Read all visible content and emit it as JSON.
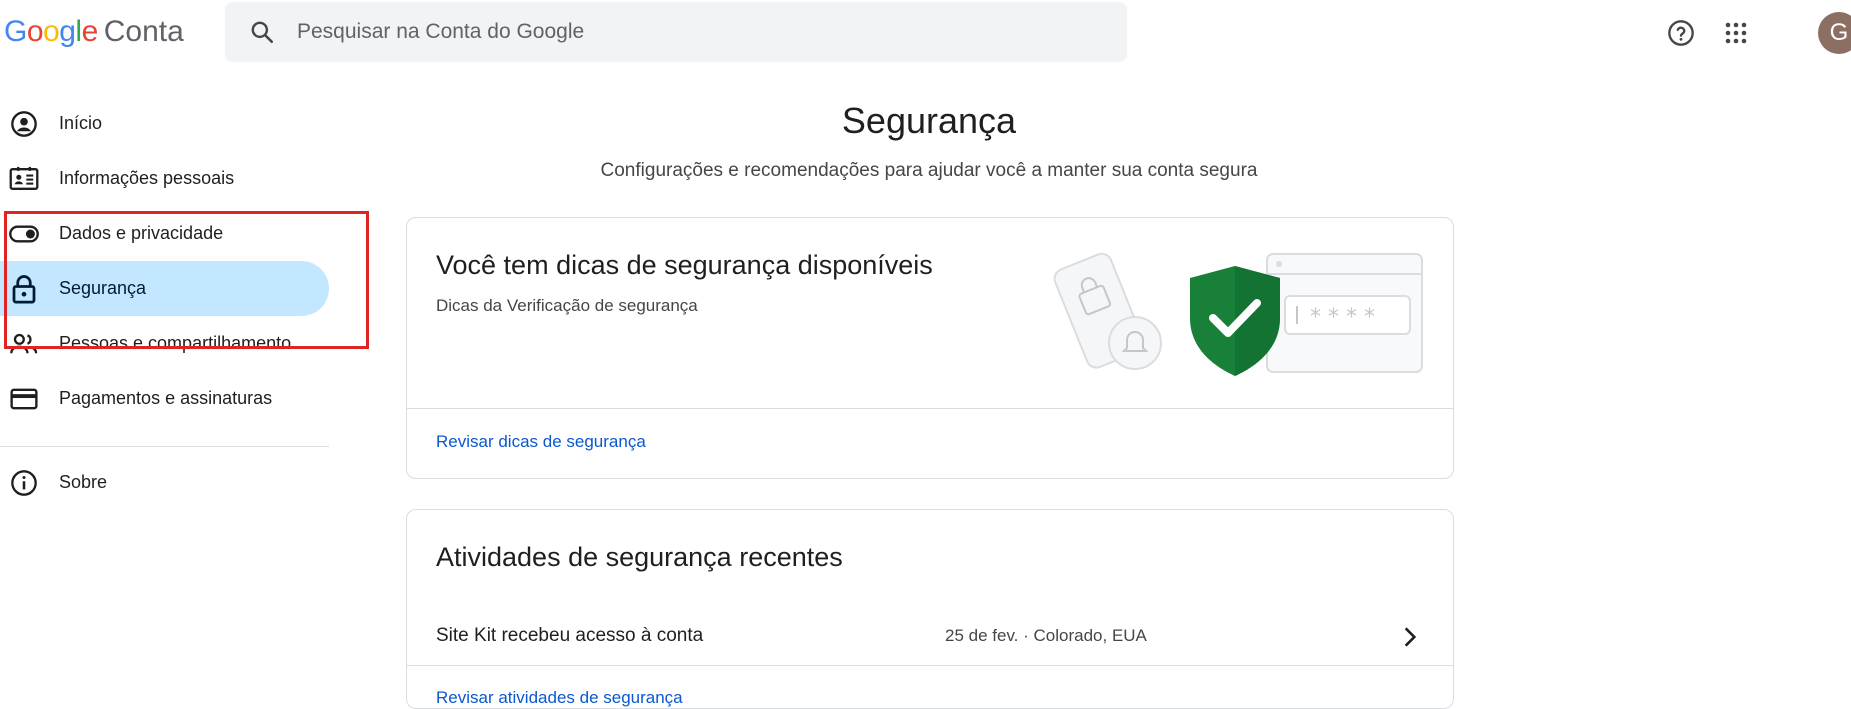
{
  "header": {
    "logo_google": "Google",
    "logo_product": "Conta",
    "search_placeholder": "Pesquisar na Conta do Google",
    "avatar_initial": "G",
    "help_icon": "help-circle-icon",
    "apps_icon": "apps-grid-icon"
  },
  "sidebar": {
    "items": [
      {
        "label": "Início",
        "icon": "account-circle-icon"
      },
      {
        "label": "Informações pessoais",
        "icon": "id-card-icon"
      },
      {
        "label": "Dados e privacidade",
        "icon": "toggle-icon"
      },
      {
        "label": "Segurança",
        "icon": "lock-icon",
        "active": true
      },
      {
        "label": "Pessoas e compartilhamento",
        "icon": "people-icon"
      },
      {
        "label": "Pagamentos e assinaturas",
        "icon": "credit-card-icon"
      }
    ],
    "about": {
      "label": "Sobre",
      "icon": "info-icon"
    }
  },
  "main": {
    "title": "Segurança",
    "subtitle": "Configurações e recomendações para ajudar você a manter sua conta segura",
    "tips_card": {
      "title": "Você tem dicas de segurança disponíveis",
      "subtitle": "Dicas da Verificação de segurança",
      "link": "Revisar dicas de segurança"
    },
    "activity_card": {
      "title": "Atividades de segurança recentes",
      "row_text": "Site Kit recebeu acesso à conta",
      "row_meta": "25 de fev. · Colorado, EUA",
      "link": "Revisar atividades de segurança"
    }
  },
  "colors": {
    "active_nav_bg": "#c2e7ff",
    "link": "#0b57d0",
    "shield": "#188038",
    "highlight_box": "#e02424"
  }
}
